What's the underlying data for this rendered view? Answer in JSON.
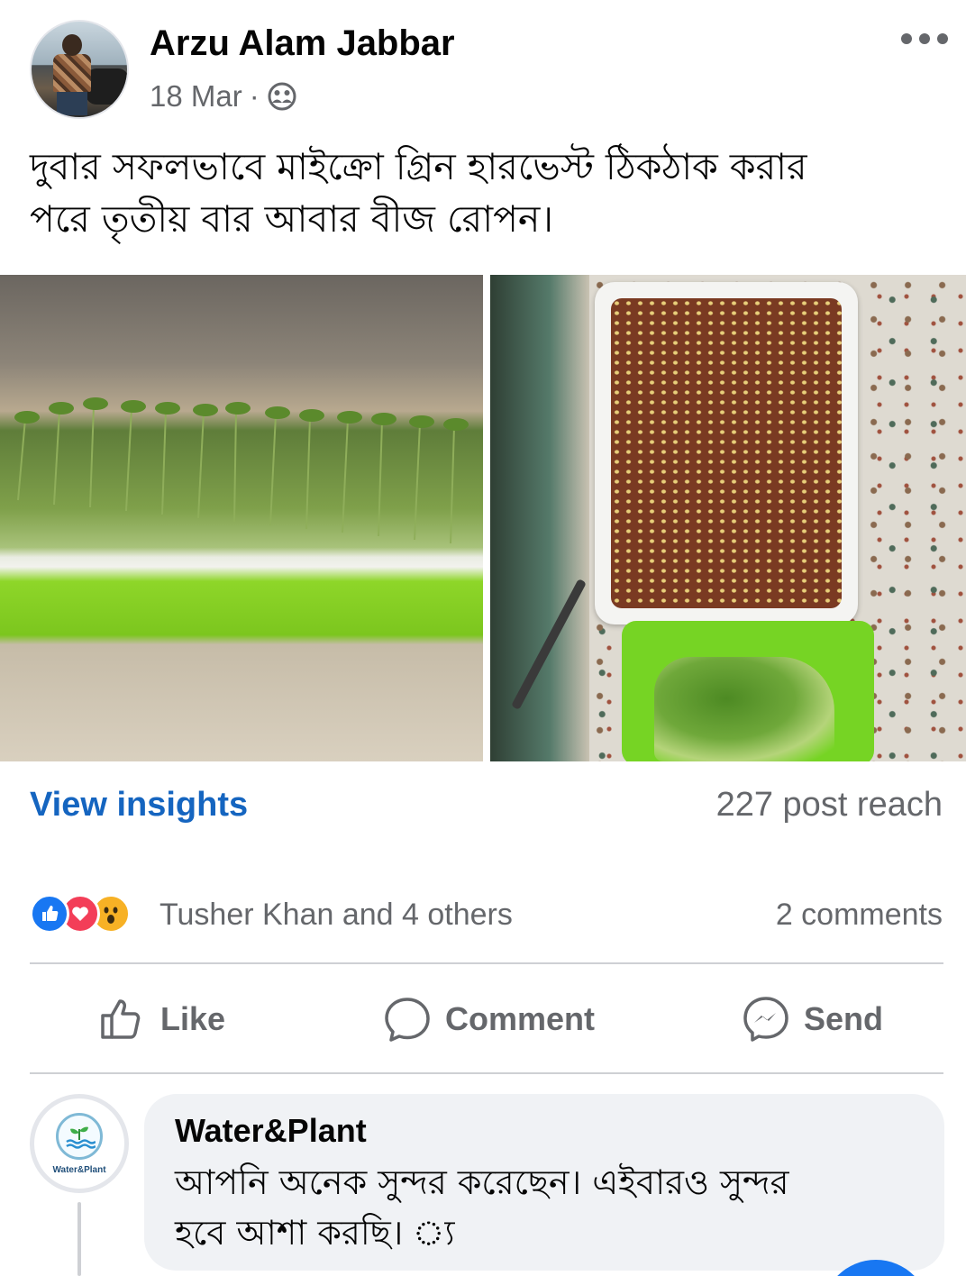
{
  "post": {
    "author": "Arzu Alam Jabbar",
    "date": "18 Mar",
    "separator": "·",
    "audience_icon": "friends-icon",
    "more_icon": "more-dots-icon",
    "text_line1": "দুবার সফলভাবে মাইক্রো গ্রিন হারভেস্ট ঠিকঠাক করার",
    "text_line2": "পরে তৃতীয় বার আবার বীজ রোপন।"
  },
  "photos": [
    {
      "description_icon": "microgreens-tray-photo"
    },
    {
      "description_icon": "seed-tray-photo"
    }
  ],
  "insights": {
    "link_label": "View insights",
    "reach": "227 post reach"
  },
  "reactions": {
    "icons": [
      "like-icon",
      "love-icon",
      "wow-icon"
    ],
    "names": "Tusher Khan and 4 others",
    "comments": "2 comments"
  },
  "actions": {
    "like": "Like",
    "comment": "Comment",
    "send": "Send"
  },
  "comment": {
    "author": "Water&Plant",
    "avatar_label": "Water&Plant",
    "text_line1": "আপনি অনেক সুন্দর করেছেন। এইবারও সুন্দর",
    "text_line2": "হবে আশা করছি। ্য"
  },
  "colors": {
    "link_blue": "#1565c0",
    "like_blue": "#1877f2",
    "love_red": "#f33e58",
    "wow_yellow": "#f7b125",
    "muted_text": "#65676b",
    "bubble_bg": "#f0f2f5"
  }
}
